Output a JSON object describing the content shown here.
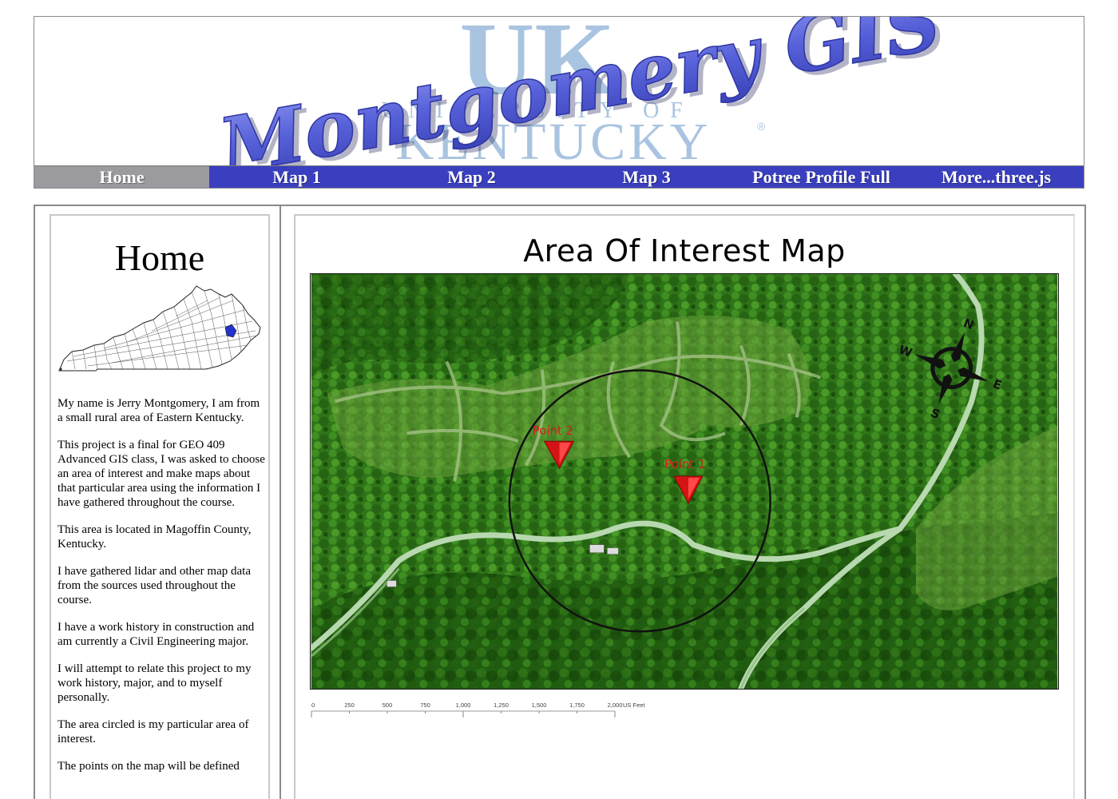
{
  "header": {
    "logo_title": "Montgomery GIS",
    "logo_mark": "UK",
    "university_line1": "UNIVERSITY OF",
    "university_line2": "KENTUCKY",
    "registered_mark": "®"
  },
  "nav": {
    "items": [
      {
        "label": "Home",
        "active": true
      },
      {
        "label": "Map 1",
        "active": false
      },
      {
        "label": "Map 2",
        "active": false
      },
      {
        "label": "Map 3",
        "active": false
      },
      {
        "label": "Potree Profile Full",
        "active": false
      },
      {
        "label": "More...three.js",
        "active": false
      }
    ]
  },
  "sidebar": {
    "title": "Home",
    "map_icon": "kentucky-county-map",
    "paragraphs": [
      "My name is Jerry Montgomery, I am from a small rural area of Eastern Kentucky.",
      "This project is a final for GEO 409 Advanced GIS class, I was asked to choose an area of interest and make maps about that particular area using the information I have gathered throughout the course.",
      "This area is located in Magoffin County, Kentucky.",
      "I have gathered lidar and other map data from the sources used throughout the course.",
      "I have a work history in construction and am currently a Civil Engineering major.",
      "I will attempt to relate this project to my work history, major, and to myself personally.",
      "The area circled is my particular area of interest.",
      "The points on the map will be defined"
    ]
  },
  "main": {
    "map_title": "Area Of Interest Map",
    "points": [
      {
        "label": "Point 2"
      },
      {
        "label": "Point 1"
      }
    ],
    "compass": {
      "n": "N",
      "s": "S",
      "e": "E",
      "w": "W"
    },
    "scalebar": {
      "ticks": [
        "0",
        "250",
        "500",
        "750",
        "1,000",
        "1,250",
        "1,500",
        "1,750",
        "2,000"
      ],
      "unit": "US Feet"
    }
  },
  "colors": {
    "nav_bg": "#3a3fc0",
    "nav_active": "#9a9a9f",
    "logo_blue": "#5a62d8",
    "uk_light_blue": "#a9c4e0",
    "point_red": "#e01818"
  }
}
